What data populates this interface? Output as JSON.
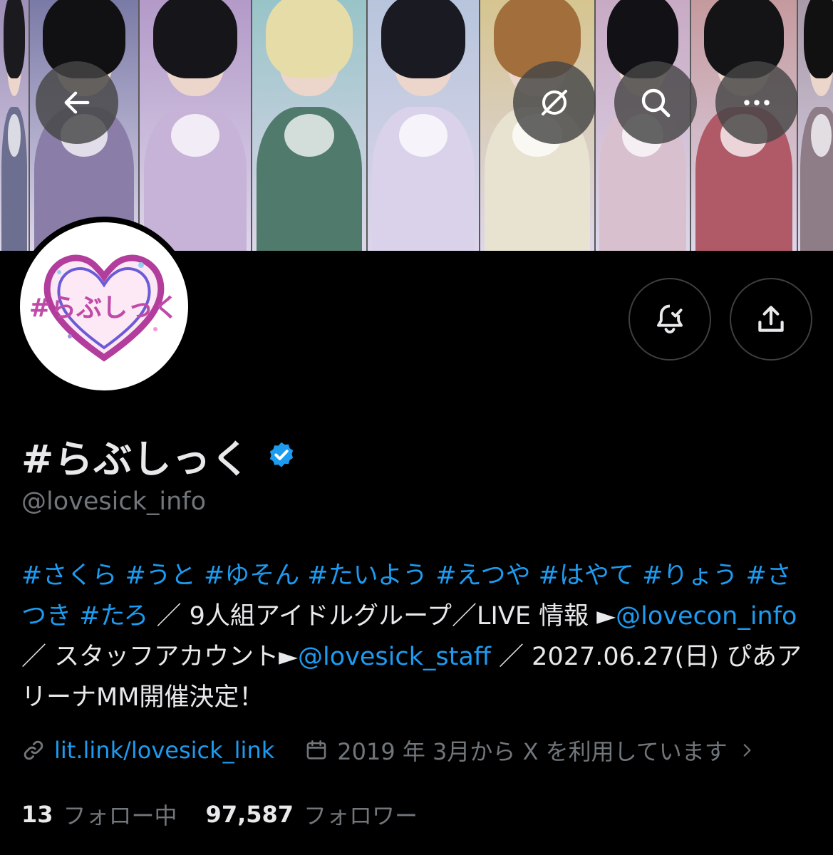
{
  "header": {
    "back_icon": "arrow-left-icon",
    "grok_icon": "grok-icon",
    "search_icon": "search-icon",
    "more_icon": "more-horizontal-icon"
  },
  "banner": {
    "panels": [
      {
        "hair": "#1a1a1f",
        "bg": "#9d8fb7",
        "outfit": "#6d6f90"
      },
      {
        "hair": "#111114",
        "bg": "#7a7aa6",
        "outfit": "#8a7ea8"
      },
      {
        "hair": "#15151a",
        "bg": "#b39ac8",
        "outfit": "#c7b3d8"
      },
      {
        "hair": "#e6dca8",
        "bg": "#98c4c7",
        "outfit": "#4f7a6c"
      },
      {
        "hair": "#1a1a22",
        "bg": "#b7c5dc",
        "outfit": "#d9d2ea"
      },
      {
        "hair": "#a26f3c",
        "bg": "#d6c58f",
        "outfit": "#e8e2d0"
      },
      {
        "hair": "#121216",
        "bg": "#c8aac4",
        "outfit": "#d8c0cf"
      },
      {
        "hair": "#141417",
        "bg": "#c59a9e",
        "outfit": "#b05a68"
      },
      {
        "hair": "#111",
        "bg": "#a89aa8",
        "outfit": "#8e7c86"
      }
    ]
  },
  "profile": {
    "avatar_logo_text": "#らぶしっく",
    "display_name": "#らぶしっく",
    "verified_icon": "verified-badge-icon",
    "handle": "@lovesick_info",
    "bell_icon": "notification-bell-check-icon",
    "share_icon": "share-icon"
  },
  "bio": {
    "tags": [
      "#さくら",
      "#うと",
      "#ゆそん",
      "#たいよう",
      "#えつや",
      "#はやて",
      "#りょう",
      "#さつき",
      "#たろ"
    ],
    "text_1": " ／ 9人組アイドルグループ／LIVE 情報 ►",
    "mention_1": "@lovecon_info",
    "text_2": " ／ スタッフアカウント►",
    "mention_2": "@lovesick_staff",
    "text_3": " ／ 2027.06.27(日) ぴあアリーナMM開催決定！"
  },
  "meta": {
    "link_icon": "link-icon",
    "link": "lit.link/lovesick_link",
    "calendar_icon": "calendar-icon",
    "joined": "2019 年 3月から X を利用しています",
    "chevron_icon": "chevron-right-icon"
  },
  "stats": {
    "following_count": "13",
    "following_label": "フォロー中",
    "followers_count": "97,587",
    "followers_label": "フォロワー"
  },
  "colors": {
    "accent": "#1d9bf0",
    "secondary_text": "#71767b",
    "verified": "#1d9bf0"
  }
}
